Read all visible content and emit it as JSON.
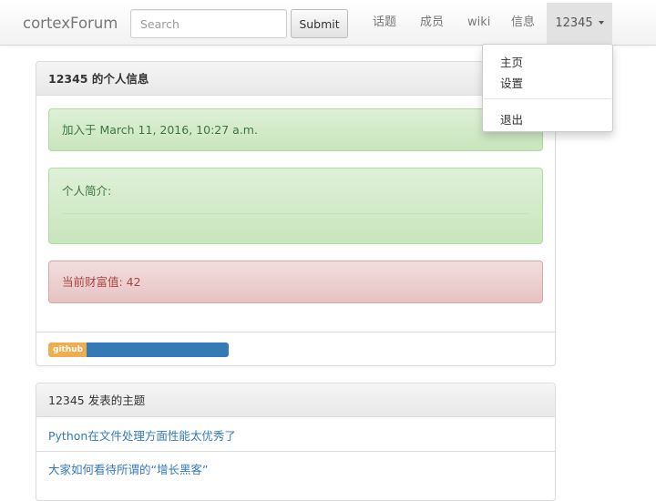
{
  "navbar": {
    "brand": "cortexForum",
    "search_placeholder": "Search",
    "submit_label": "Submit",
    "items": [
      {
        "label": "话题"
      },
      {
        "label": "成员"
      },
      {
        "label": "wiki"
      },
      {
        "label": "信息"
      }
    ],
    "user": "12345"
  },
  "dropdown": {
    "items": [
      "主页",
      "设置",
      "退出"
    ]
  },
  "profile": {
    "heading": "12345 的个人信息",
    "joined": "加入于 March 11, 2016, 10:27 a.m.",
    "bio_label": "个人简介:",
    "wealth": "当前财富值: 42",
    "github_label": "github"
  },
  "topics": {
    "heading": "12345 发表的主题",
    "items": [
      "Python在文件处理方面性能太优秀了",
      "大家如何看待所谓的“增长黑客”"
    ]
  },
  "colors": {
    "link": "#337ab7",
    "success_text": "#3c763d",
    "danger_text": "#a94442",
    "badge_orange": "#f0ad4e"
  }
}
